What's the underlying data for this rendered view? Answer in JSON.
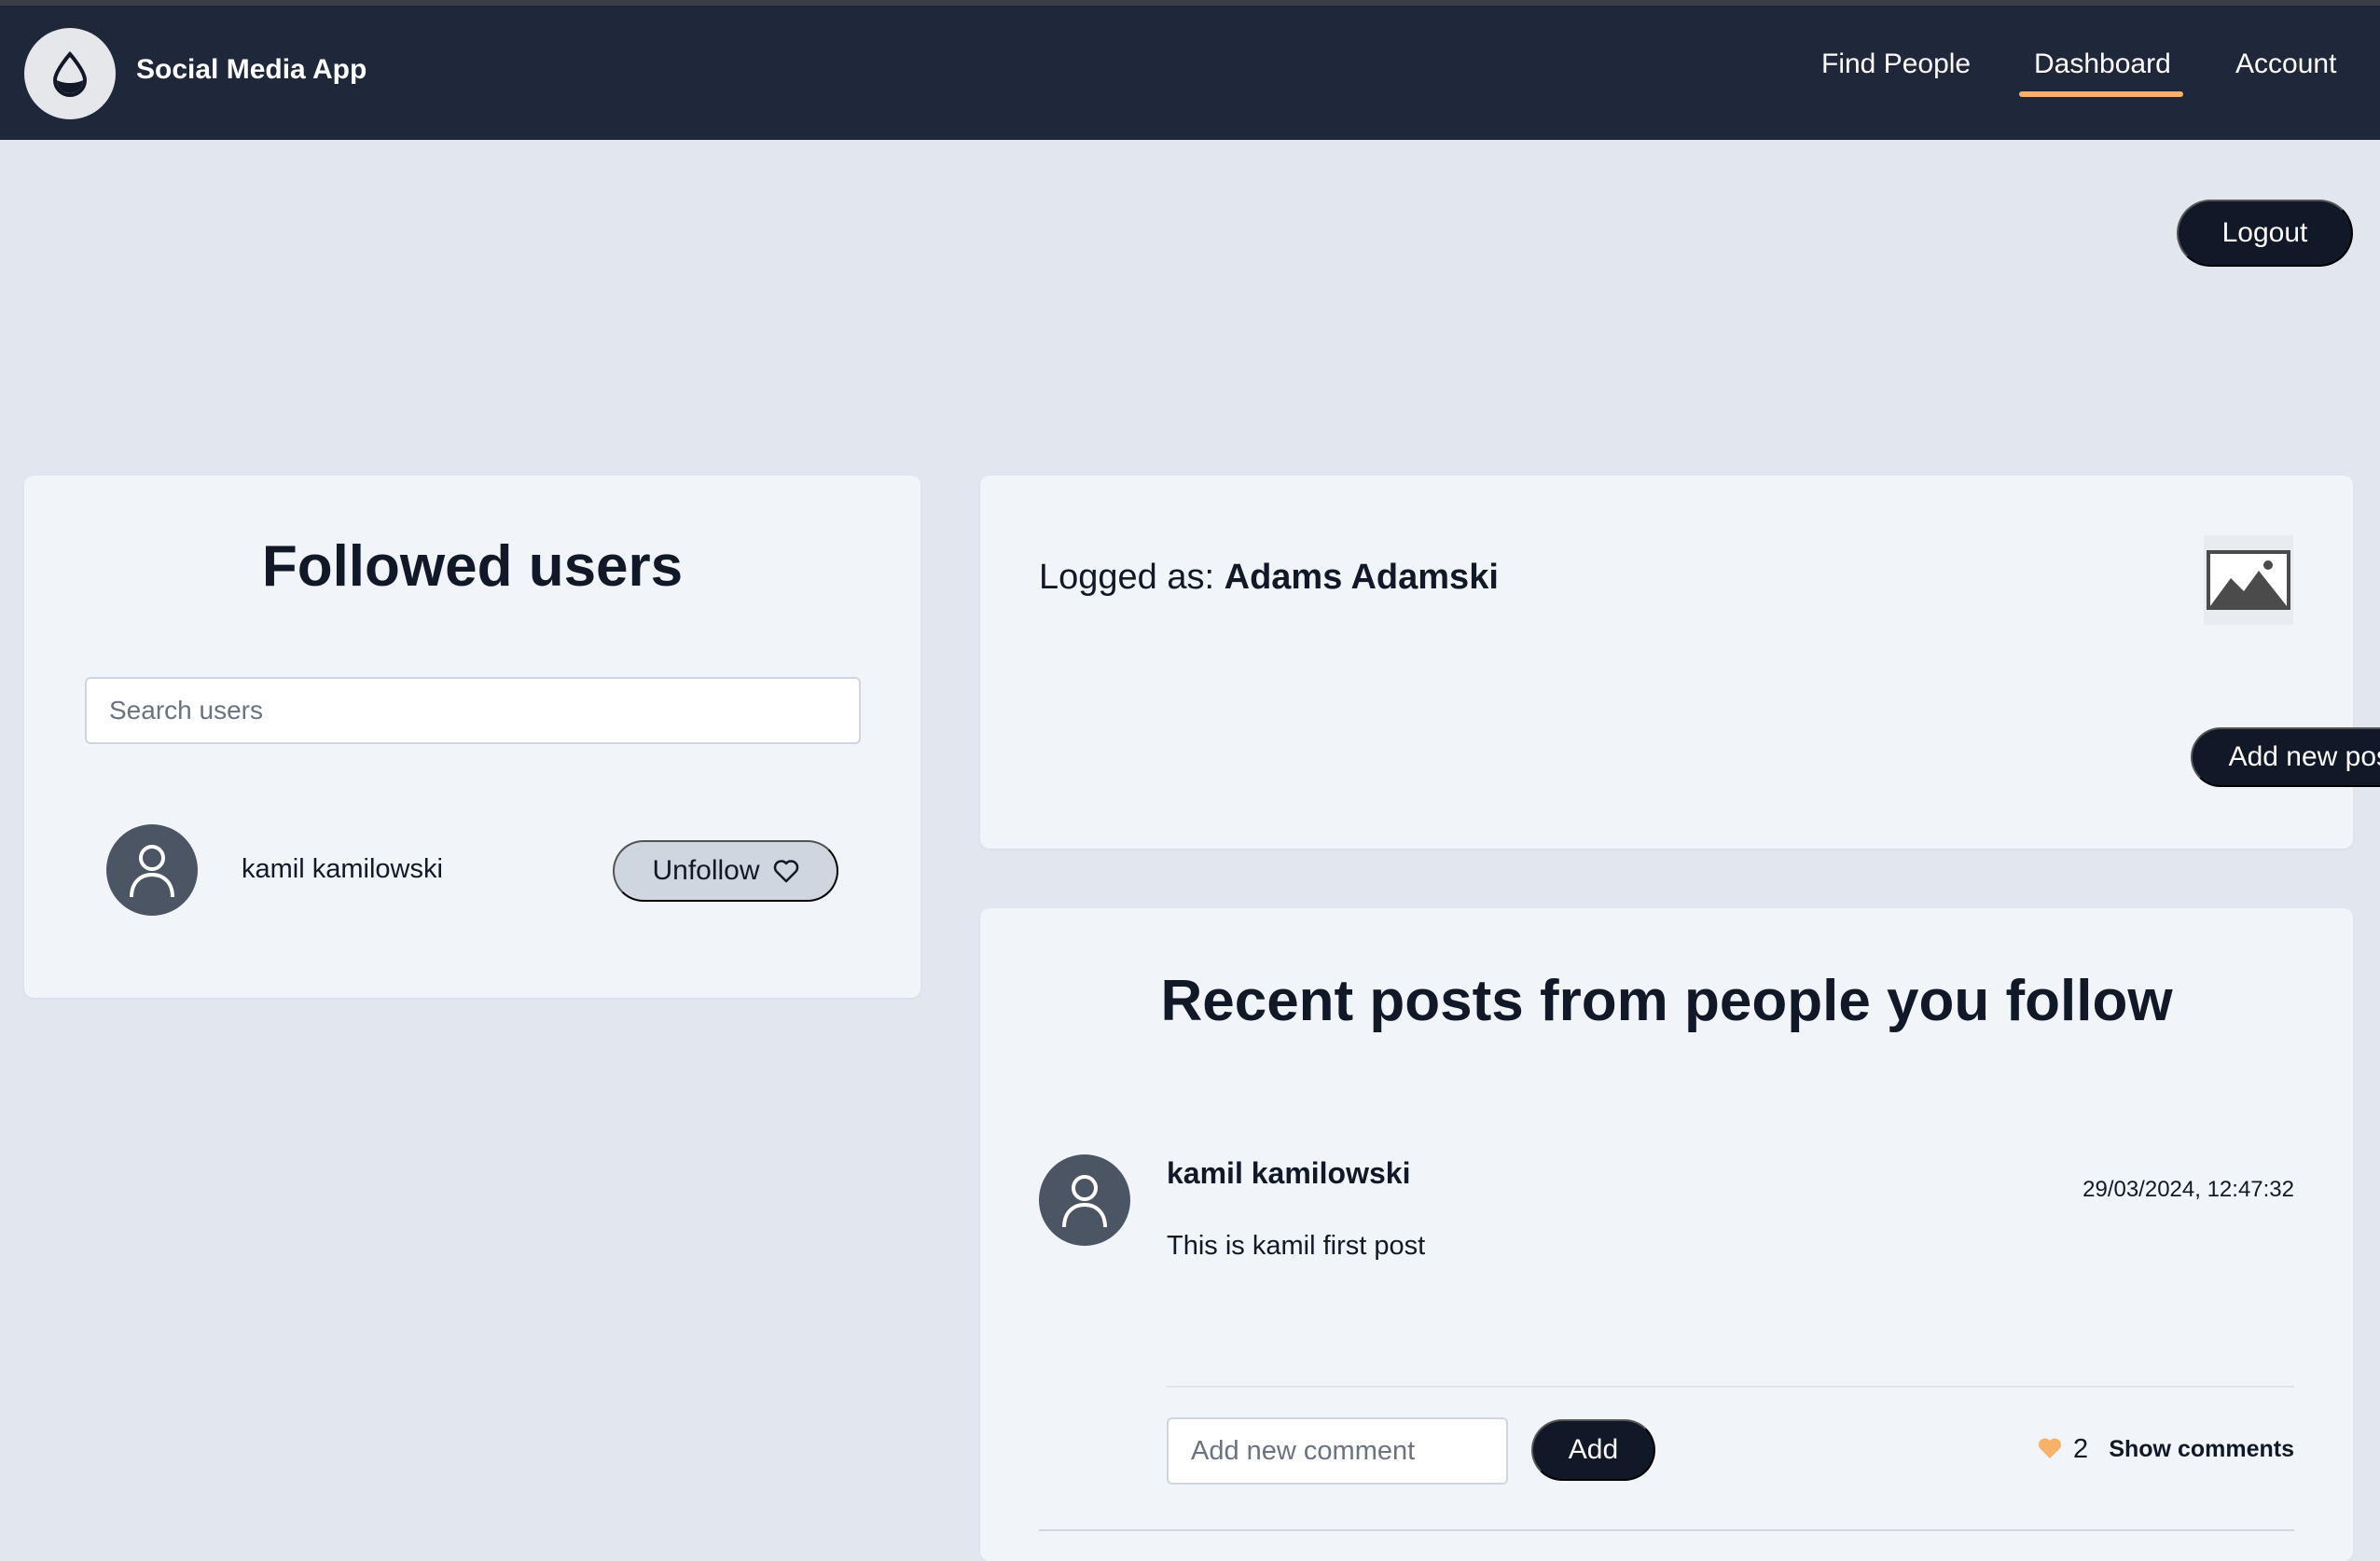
{
  "app": {
    "title": "Social Media App",
    "logo_icon": "water-drop-icon"
  },
  "nav": {
    "find_people": "Find People",
    "dashboard": "Dashboard",
    "account": "Account",
    "active": "Dashboard"
  },
  "logout_label": "Logout",
  "followed": {
    "title": "Followed users",
    "search_placeholder": "Search users",
    "users": [
      {
        "name": "kamil kamilowski",
        "action_label": "Unfollow"
      }
    ]
  },
  "profile": {
    "logged_prefix": "Logged as:",
    "user_name": "Adams Adamski",
    "add_post_label": "Add new post"
  },
  "feed": {
    "title": "Recent posts from people you follow",
    "posts": [
      {
        "author": "kamil kamilowski",
        "date": "29/03/2024, 12:47:32",
        "text": "This is kamil first post",
        "comment_placeholder": "Add new comment",
        "add_label": "Add",
        "likes": "2",
        "show_comments_label": "Show comments"
      }
    ]
  },
  "colors": {
    "navbar": "#1f283b",
    "accent_underline": "#f6b26b",
    "button_dark": "#111827",
    "page_bg": "#e2e7ef",
    "card_bg": "#f1f4f9",
    "like_heart": "#f6b26b"
  }
}
